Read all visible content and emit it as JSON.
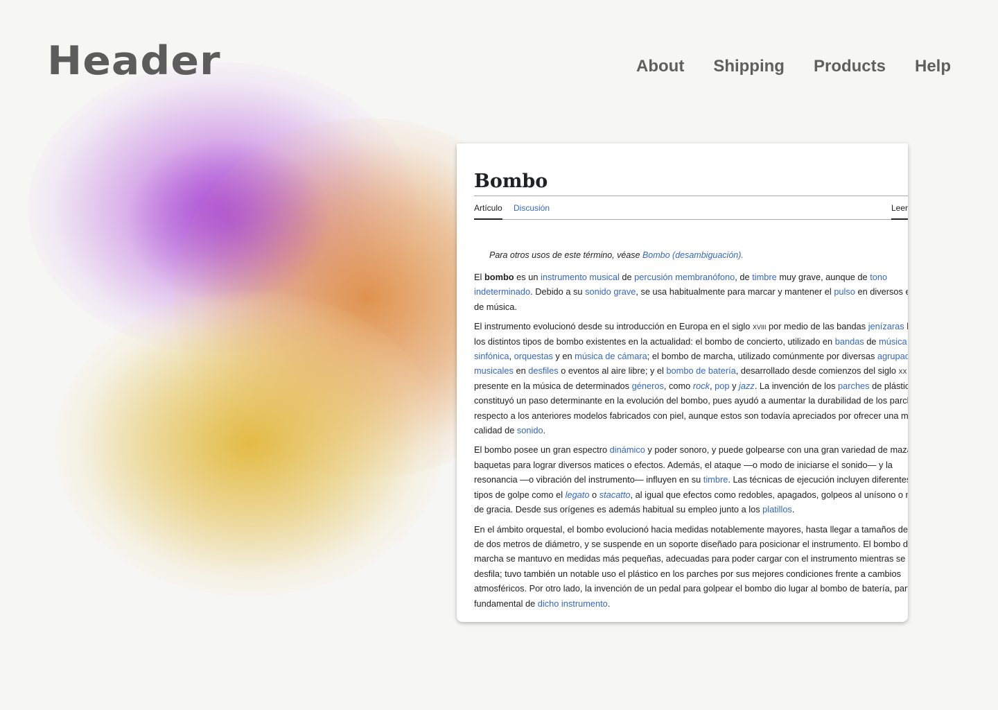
{
  "header": {
    "logo": "Header",
    "nav": [
      "About",
      "Shipping",
      "Products",
      "Help"
    ]
  },
  "article": {
    "title": "Bombo",
    "tabs": {
      "article": "Artículo",
      "talk": "Discusión",
      "read": "Leer"
    },
    "hatnote_text": "Para otros usos de este término, véase ",
    "hatnote_link": "Bombo (desambiguación)."
  },
  "colors": {
    "link": "#3366cc",
    "text": "#202122",
    "header_text": "#5c5c5c",
    "background": "#f6f6f5",
    "blob_purple": "#b050d7",
    "blob_orange": "#dc8232",
    "blob_yellow": "#e1b432"
  },
  "paragraphs": [
    [
      {
        "t": "El "
      },
      {
        "t": "bombo",
        "b": true
      },
      {
        "t": " es un "
      },
      {
        "t": "instrumento musical",
        "link": true
      },
      {
        "t": " de "
      },
      {
        "t": "percusión membranófono",
        "link": true
      },
      {
        "t": ", de "
      },
      {
        "t": "timbre",
        "link": true
      },
      {
        "t": " muy grave, aunque de "
      },
      {
        "t": "tono indeterminado",
        "link": true
      },
      {
        "t": ". Debido a su "
      },
      {
        "t": "sonido grave",
        "link": true
      },
      {
        "t": ", se usa habitualmente para marcar y mantener el "
      },
      {
        "t": "pulso",
        "link": true
      },
      {
        "t": " en diversos estilos de música."
      }
    ],
    [
      {
        "t": "El instrumento evolucionó desde su introducción en Europa en el siglo "
      },
      {
        "t": "xviii",
        "sc": true
      },
      {
        "t": " por medio de las bandas "
      },
      {
        "t": "jenízaras",
        "link": true
      },
      {
        "t": " hasta los distintos tipos de bombo existentes en la actualidad: el bombo de concierto, utilizado en "
      },
      {
        "t": "bandas",
        "link": true
      },
      {
        "t": " de "
      },
      {
        "t": "música sinfónica",
        "link": true
      },
      {
        "t": ", "
      },
      {
        "t": "orquestas",
        "link": true
      },
      {
        "t": " y en "
      },
      {
        "t": "música de cámara",
        "link": true
      },
      {
        "t": "; el bombo de marcha, utilizado comúnmente por diversas "
      },
      {
        "t": "agrupaciones musicales",
        "link": true
      },
      {
        "t": " en "
      },
      {
        "t": "desfiles",
        "link": true
      },
      {
        "t": " o eventos al aire libre; y el "
      },
      {
        "t": "bombo de batería",
        "link": true
      },
      {
        "t": ", desarrollado desde comienzos del siglo "
      },
      {
        "t": "xx",
        "sc": true
      },
      {
        "t": " y presente en la música de determinados "
      },
      {
        "t": "géneros",
        "link": true
      },
      {
        "t": ", como "
      },
      {
        "t": "rock",
        "link": true,
        "i": true
      },
      {
        "t": ", "
      },
      {
        "t": "pop",
        "link": true
      },
      {
        "t": " y "
      },
      {
        "t": "jazz",
        "link": true,
        "i": true
      },
      {
        "t": ". La invención de los "
      },
      {
        "t": "parches",
        "link": true
      },
      {
        "t": " de plástico constituyó un paso determinante en la evolución del bombo, pues ayudó a aumentar la durabilidad de los parches respecto a los anteriores modelos fabricados con piel, aunque estos son todavía apreciados por ofrecer una mayor calidad de "
      },
      {
        "t": "sonido",
        "link": true
      },
      {
        "t": "."
      }
    ],
    [
      {
        "t": "El bombo posee un gran espectro "
      },
      {
        "t": "dinámico",
        "link": true
      },
      {
        "t": " y poder sonoro, y puede golpearse con una gran variedad de mazas y baquetas para lograr diversos matices o efectos. Además, el ataque —o modo de iniciarse el sonido— y la resonancia —o vibración del instrumento— influyen en su "
      },
      {
        "t": "timbre",
        "link": true
      },
      {
        "t": ". Las técnicas de ejecución incluyen diferentes tipos de golpe como el "
      },
      {
        "t": "legato",
        "link": true,
        "i": true
      },
      {
        "t": " o "
      },
      {
        "t": "stacatto",
        "link": true,
        "i": true
      },
      {
        "t": ", al igual que efectos como redobles, apagados, golpeos al unísono o notas de gracia. Desde sus orígenes es además habitual su empleo junto a los "
      },
      {
        "t": "platillos",
        "link": true
      },
      {
        "t": "."
      }
    ],
    [
      {
        "t": "En el ámbito orquestal, el bombo evolucionó hacia medidas notablemente mayores, hasta llegar a tamaños de más de dos metros de diámetro, y se suspende en un soporte diseñado para posicionar el instrumento. El bombo de marcha se mantuvo en medidas más pequeñas, adecuadas para poder cargar con el instrumento mientras se desfila; tuvo también un notable uso el plástico en los parches por sus mejores condiciones frente a cambios atmosféricos. Por otro lado, la invención de un pedal para golpear el bombo dio lugar al bombo de batería, parte fundamental de "
      },
      {
        "t": "dicho instrumento",
        "link": true
      },
      {
        "t": "."
      }
    ]
  ]
}
